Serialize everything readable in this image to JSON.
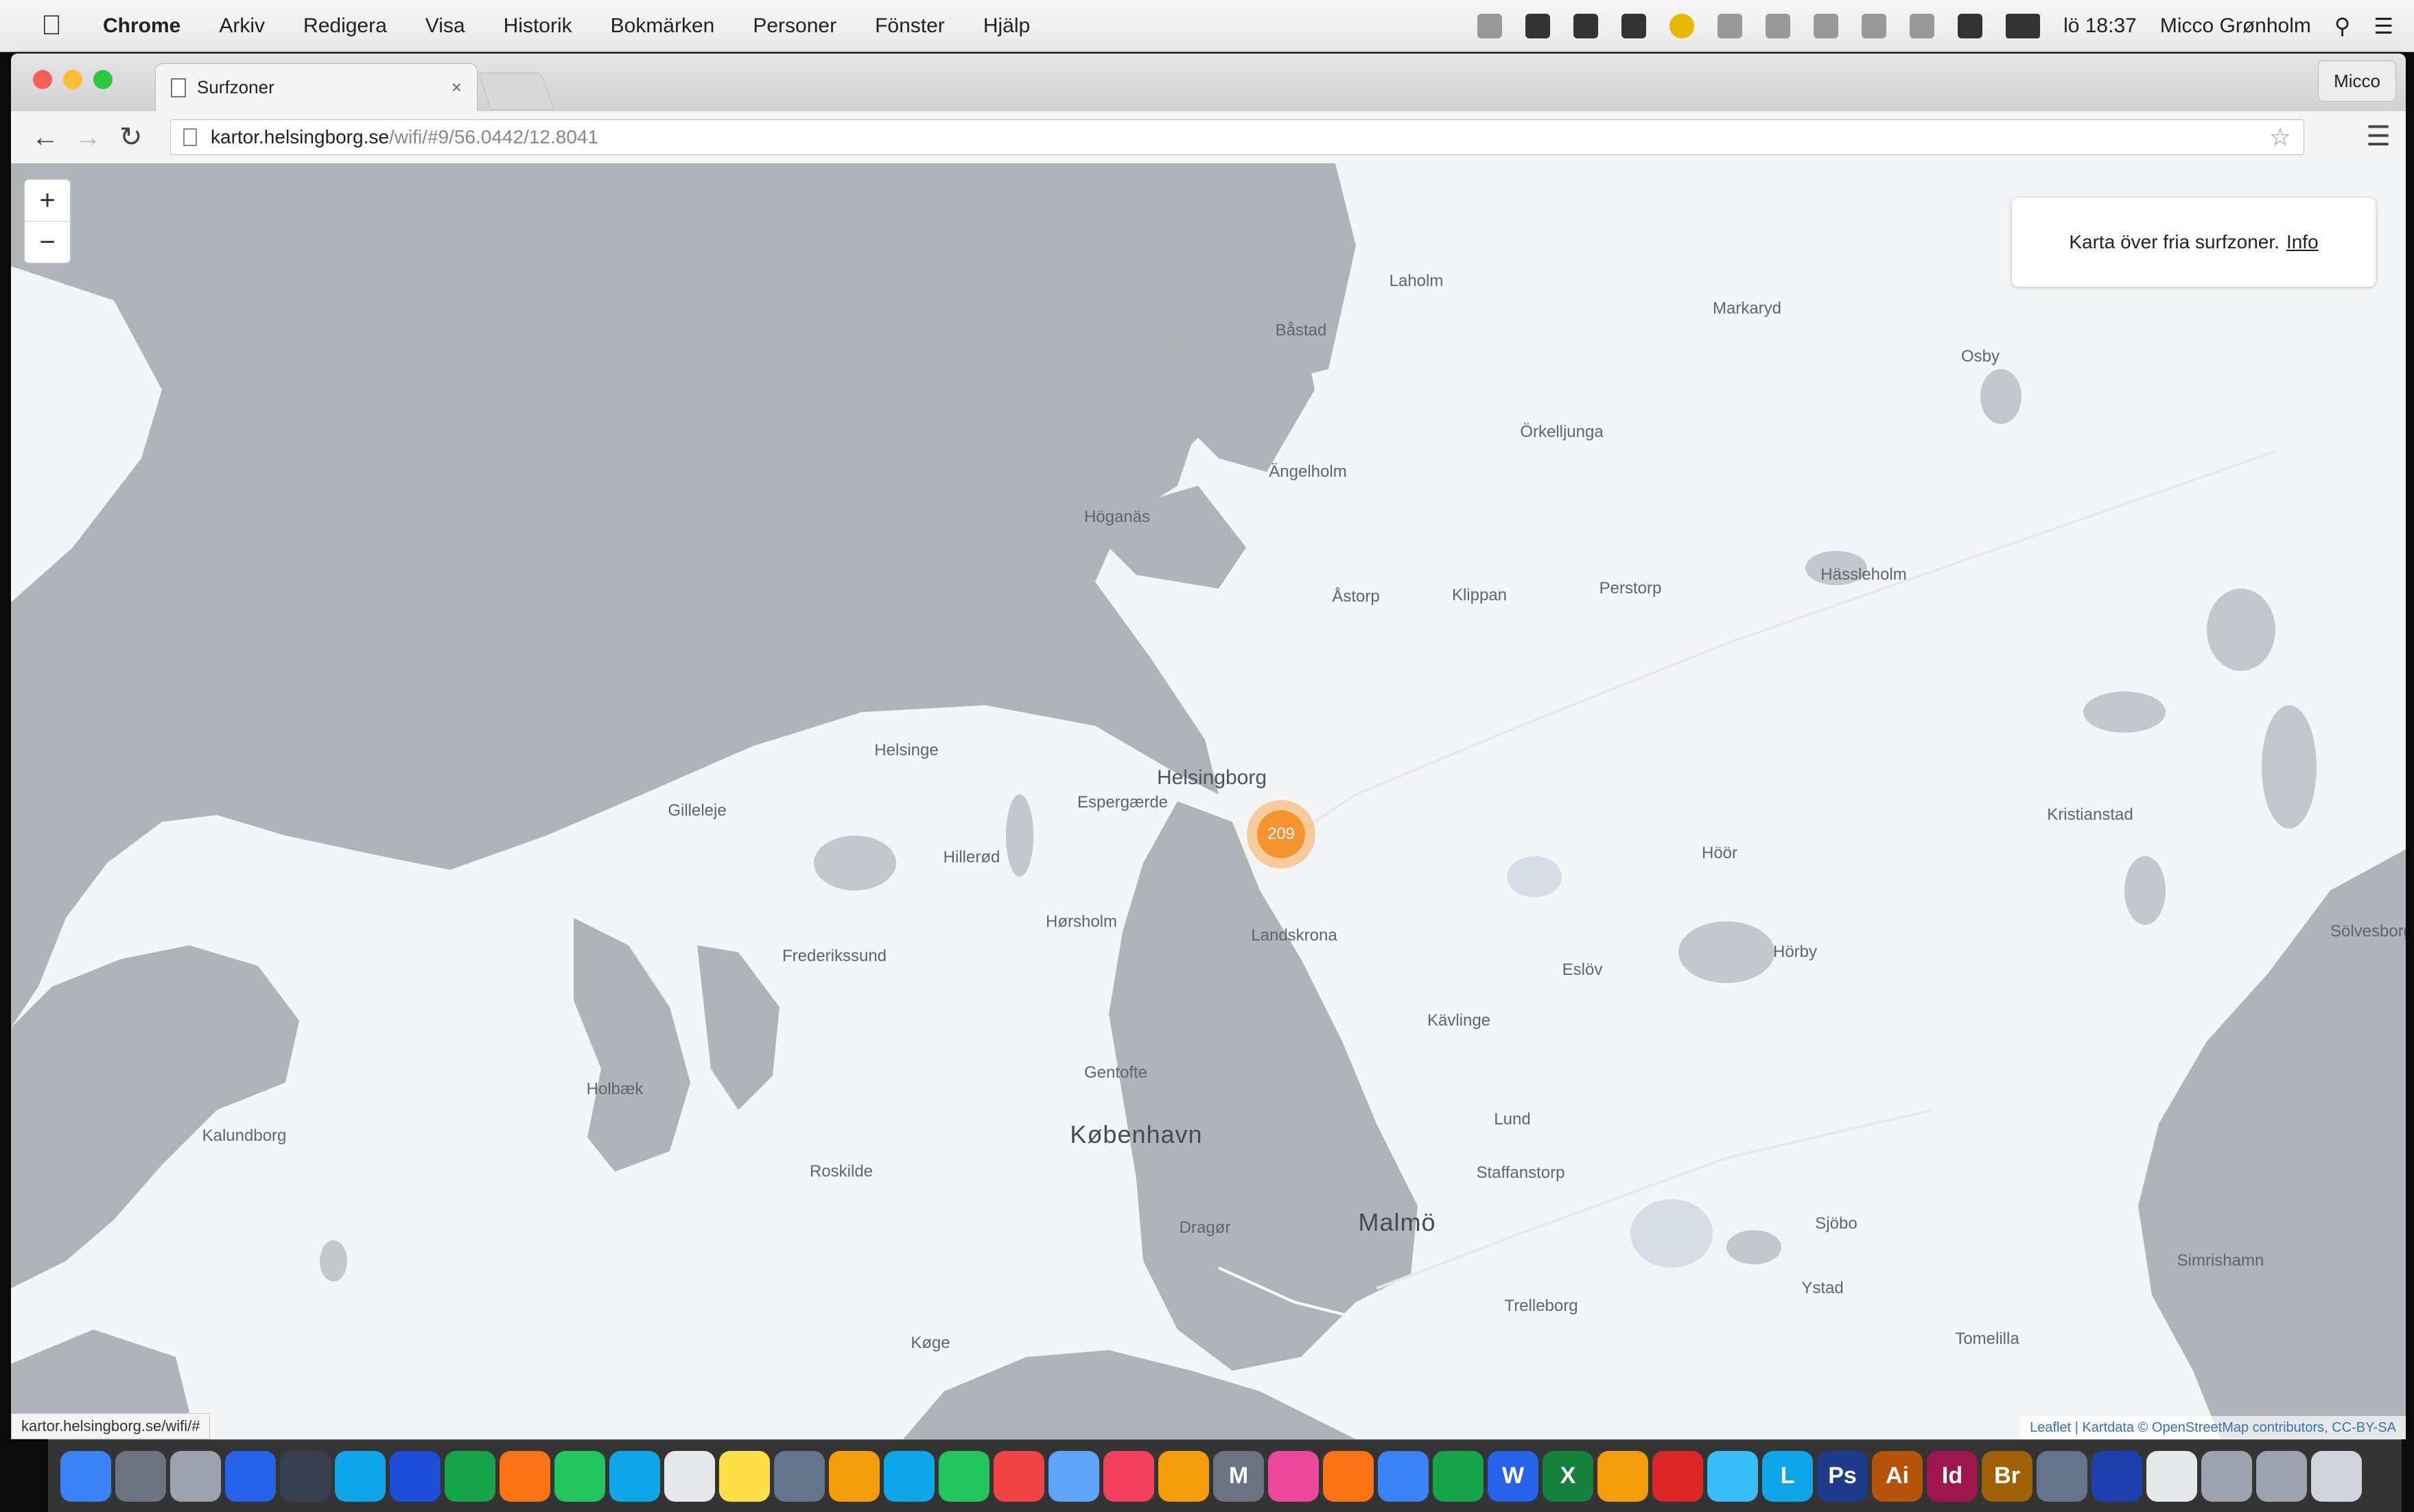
{
  "menubar": {
    "app_name": "Chrome",
    "items": [
      "Arkiv",
      "Redigera",
      "Visa",
      "Historik",
      "Bokmärken",
      "Personer",
      "Fönster",
      "Hjälp"
    ],
    "clock": "lö 18:37",
    "user": "Micco Grønholm"
  },
  "browser": {
    "tab_title": "Surfzoner",
    "tab_close": "×",
    "profile_label": "Micco",
    "url_host": "kartor.helsingborg.se",
    "url_path": "/wifi/#9/56.0442/12.8041"
  },
  "map": {
    "zoom_in": "+",
    "zoom_out": "−",
    "info_text": "Karta över fria surfzoner.",
    "info_link": "Info",
    "cluster_count": "209",
    "attribution": "Leaflet | Kartdata © OpenStreetMap contributors, CC-BY-SA",
    "status_url": "kartor.helsingborg.se/wifi/#",
    "places": [
      {
        "key": "laholm",
        "name": "Laholm"
      },
      {
        "key": "markaryd",
        "name": "Markaryd"
      },
      {
        "key": "bastad",
        "name": "Båstad"
      },
      {
        "key": "orkelljunga",
        "name": "Örkelljunga"
      },
      {
        "key": "osby",
        "name": "Osby"
      },
      {
        "key": "angelholm",
        "name": "Ängelholm"
      },
      {
        "key": "hoganas",
        "name": "Höganäs"
      },
      {
        "key": "astorp",
        "name": "Åstorp"
      },
      {
        "key": "klippan",
        "name": "Klippan"
      },
      {
        "key": "perstorp",
        "name": "Perstorp"
      },
      {
        "key": "hassleholm",
        "name": "Hässleholm"
      },
      {
        "key": "helsingborg",
        "name": "Helsingborg"
      },
      {
        "key": "helsinge",
        "name": "Helsinge"
      },
      {
        "key": "gilleleje",
        "name": "Gilleleje"
      },
      {
        "key": "espergaerde",
        "name": "Espergærde"
      },
      {
        "key": "hillerod",
        "name": "Hillerød"
      },
      {
        "key": "horsholm",
        "name": "Hørsholm"
      },
      {
        "key": "landskrona",
        "name": "Landskrona"
      },
      {
        "key": "hoor",
        "name": "Höör"
      },
      {
        "key": "horby",
        "name": "Hörby"
      },
      {
        "key": "eslov",
        "name": "Eslöv"
      },
      {
        "key": "kavlinge",
        "name": "Kävlinge"
      },
      {
        "key": "kristianstad",
        "name": "Kristianstad"
      },
      {
        "key": "frederikssund",
        "name": "Frederikssund"
      },
      {
        "key": "kobenhavn",
        "name": "København"
      },
      {
        "key": "malmo",
        "name": "Malmö"
      },
      {
        "key": "lund",
        "name": "Lund"
      },
      {
        "key": "staffanstorp",
        "name": "Staffanstorp"
      },
      {
        "key": "trelleborg",
        "name": "Trelleborg"
      },
      {
        "key": "ystad",
        "name": "Ystad"
      },
      {
        "key": "simrishamn",
        "name": "Simrishamn"
      },
      {
        "key": "roskilde",
        "name": "Roskilde"
      },
      {
        "key": "kalundborg",
        "name": "Kalundborg"
      },
      {
        "key": "holbaek",
        "name": "Holbæk"
      },
      {
        "key": "dragor",
        "name": "Dragør"
      },
      {
        "key": "koge",
        "name": "Køge"
      },
      {
        "key": "gentofte",
        "name": "Gentofte"
      },
      {
        "key": "solvesborg",
        "name": "Sölvesborg"
      },
      {
        "key": "tomelilla",
        "name": "Tomelilla"
      },
      {
        "key": "hoor2",
        "name": "Sjöbo"
      }
    ]
  },
  "dock": {
    "icons": [
      "finder-icon",
      "launchpad-icon",
      "timemachine-icon",
      "safari-icon",
      "dashboard-icon",
      "cloud-icon",
      "appstore-icon",
      "chrome-icon",
      "firefox-icon",
      "drive-icon",
      "skype-icon",
      "notes-icon",
      "stickies-icon",
      "preview-icon",
      "settings-icon",
      "messages-icon",
      "facetime-icon",
      "calendar-icon",
      "mail-icon",
      "photos-icon",
      "headphones-icon",
      "mendeley-icon",
      "itunes-icon",
      "books-icon",
      "maps-icon",
      "facetime2-icon",
      "word-icon",
      "excel-icon",
      "powerpoint-icon",
      "acrobat-icon",
      "downloads-icon",
      "lightroom-icon",
      "photoshop-icon",
      "illustrator-icon",
      "indesign-icon",
      "bridge-icon",
      "scanner-icon",
      "screensharing-icon",
      "document-icon",
      "help-icon",
      "help2-icon",
      "trash-icon"
    ],
    "labels": {
      "word": "W",
      "excel": "X",
      "photoshop": "Ps",
      "illustrator": "Ai",
      "indesign": "Id",
      "bridge": "Br",
      "lightroom": "L",
      "mendeley": "M"
    }
  }
}
